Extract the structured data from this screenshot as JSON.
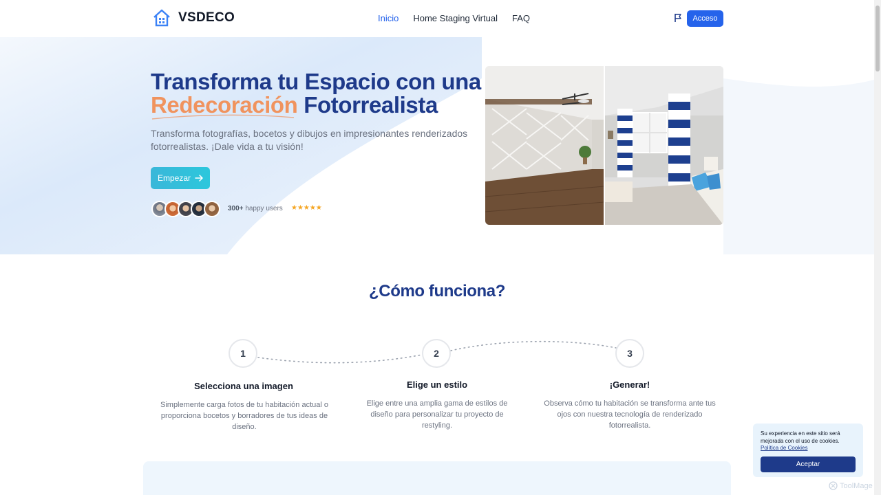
{
  "brand": {
    "name": "VSDECO",
    "logo_icon": "house-icon"
  },
  "nav": {
    "items": [
      {
        "label": "Inicio",
        "active": true
      },
      {
        "label": "Home Staging Virtual",
        "active": false
      },
      {
        "label": "FAQ",
        "active": false
      }
    ],
    "language_icon": "flag-icon",
    "login_label": "Acceso"
  },
  "hero": {
    "title_part1": "Transforma tu Espacio con una",
    "title_accent": "Redecoración",
    "title_part2": "Fotorrealista",
    "subtitle": "Transforma fotografías, bocetos y dibujos en impresionantes renderizados fotorrealistas. ¡Dale vida a tu visión!",
    "cta_label": "Empezar",
    "cta_icon": "arrow-right-icon",
    "users_count": "300+",
    "users_label": "happy users",
    "rating_stars": 5,
    "stars_text": "★★★★★"
  },
  "how": {
    "title": "¿Cómo funciona?",
    "steps": [
      {
        "number": "1",
        "title": "Selecciona una imagen",
        "text": "Simplemente carga fotos de tu habitación actual o proporciona bocetos y borradores de tus ideas de diseño."
      },
      {
        "number": "2",
        "title": "Elige un estilo",
        "text": "Elige entre una amplia gama de estilos de diseño para personalizar tu proyecto de restyling."
      },
      {
        "number": "3",
        "title": "¡Generar!",
        "text": "Observa cómo tu habitación se transforma ante tus ojos con nuestra tecnología de renderizado fotorrealista."
      }
    ]
  },
  "cookie": {
    "text": "Su experiencia en este sitio será mejorada con el uso de cookies.",
    "link": "Política de Cookies",
    "accept_label": "Aceptar"
  },
  "watermark": "ToolMage",
  "colors": {
    "primary": "#2563eb",
    "heading": "#1e3a8a",
    "accent": "#f0935e",
    "cta": "#2cc7dc"
  }
}
